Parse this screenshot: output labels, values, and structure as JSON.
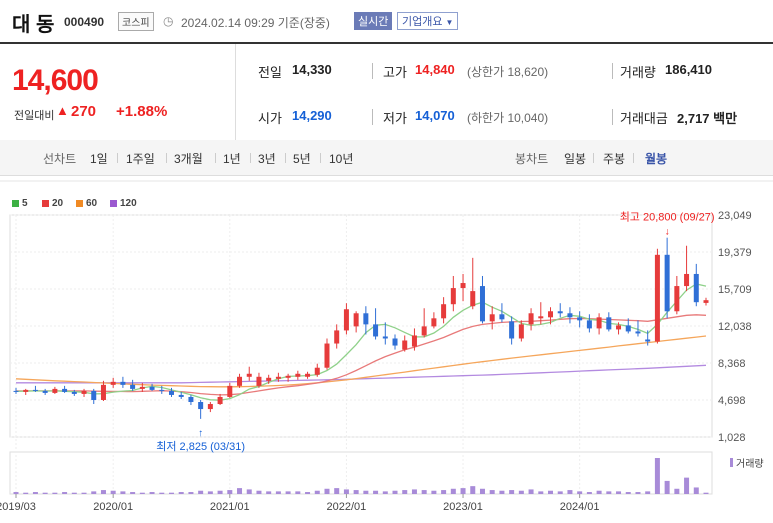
{
  "header": {
    "name": "대 동",
    "code": "000490",
    "market": "코스피",
    "datetime": "2024.02.14 09:29 기준(장중)",
    "live": "실시간",
    "company_info": "기업개요"
  },
  "quote": {
    "price": "14,600",
    "change_label": "전일대비",
    "change_arrow": "▲",
    "change": "270",
    "change_rate": "+1.88%",
    "prev_close_label": "전일",
    "prev_close": "14,330",
    "high_label": "고가",
    "high": "14,840",
    "upper_limit": "(상한가 18,620)",
    "volume_label": "거래량",
    "volume": "186,410",
    "open_label": "시가",
    "open": "14,290",
    "low_label": "저가",
    "low": "14,070",
    "lower_limit": "(하한가 10,040)",
    "value_label": "거래대금",
    "value": "2,717 백만"
  },
  "tabs": {
    "line_label": "선차트",
    "line_periods": [
      "1일",
      "1주일",
      "3개월",
      "1년",
      "3년",
      "5년",
      "10년"
    ],
    "candle_label": "봉차트",
    "candle_periods": [
      "일봉",
      "주봉",
      "월봉"
    ],
    "active_candle": "월봉"
  },
  "legend": [
    {
      "label": "5",
      "color": "#3cb043"
    },
    {
      "label": "20",
      "color": "#e63b3b"
    },
    {
      "label": "60",
      "color": "#f08a24"
    },
    {
      "label": "120",
      "color": "#9b59d0"
    }
  ],
  "colors": {
    "up": "#e63b3b",
    "down": "#2f6fd6",
    "ma5": "#8fd18a",
    "ma20": "#e87a7a",
    "ma60": "#f5a65b",
    "ma120": "#b38ae0",
    "volume": "#a88bd8"
  },
  "chart_data": {
    "type": "candlestick",
    "y_ticks": [
      "23,049",
      "19,379",
      "15,709",
      "12,038",
      "8,368",
      "4,698",
      "1,028"
    ],
    "ylim": [
      1028,
      23049
    ],
    "x_ticks": [
      "2019/03",
      "2020/01",
      "2021/01",
      "2022/01",
      "2023/01",
      "2024/01"
    ],
    "max_annotation": "최고 20,800 (09/27)",
    "min_annotation": "최저 2,825 (03/31)",
    "volume_label": "거래량",
    "candles": [
      {
        "o": 5600,
        "h": 5900,
        "l": 5300,
        "c": 5500
      },
      {
        "o": 5500,
        "h": 5800,
        "l": 5200,
        "c": 5700
      },
      {
        "o": 5700,
        "h": 6100,
        "l": 5500,
        "c": 5600
      },
      {
        "o": 5600,
        "h": 5800,
        "l": 5200,
        "c": 5400
      },
      {
        "o": 5400,
        "h": 6000,
        "l": 5300,
        "c": 5800
      },
      {
        "o": 5800,
        "h": 6100,
        "l": 5400,
        "c": 5500
      },
      {
        "o": 5500,
        "h": 5700,
        "l": 5100,
        "c": 5300
      },
      {
        "o": 5300,
        "h": 5800,
        "l": 5000,
        "c": 5600
      },
      {
        "o": 5600,
        "h": 5800,
        "l": 4300,
        "c": 4700
      },
      {
        "o": 4700,
        "h": 6600,
        "l": 4600,
        "c": 6200
      },
      {
        "o": 6200,
        "h": 6900,
        "l": 5900,
        "c": 6500
      },
      {
        "o": 6500,
        "h": 7000,
        "l": 5900,
        "c": 6200
      },
      {
        "o": 6200,
        "h": 6700,
        "l": 5600,
        "c": 5800
      },
      {
        "o": 5800,
        "h": 6400,
        "l": 5500,
        "c": 6000
      },
      {
        "o": 6000,
        "h": 6300,
        "l": 5600,
        "c": 5700
      },
      {
        "o": 5700,
        "h": 6100,
        "l": 5300,
        "c": 5600
      },
      {
        "o": 5600,
        "h": 5900,
        "l": 5000,
        "c": 5200
      },
      {
        "o": 5200,
        "h": 5500,
        "l": 4800,
        "c": 5000
      },
      {
        "o": 5000,
        "h": 5200,
        "l": 4200,
        "c": 4500
      },
      {
        "o": 4500,
        "h": 4700,
        "l": 2825,
        "c": 3800
      },
      {
        "o": 3800,
        "h": 4500,
        "l": 3500,
        "c": 4300
      },
      {
        "o": 4300,
        "h": 5300,
        "l": 4200,
        "c": 5000
      },
      {
        "o": 5000,
        "h": 6400,
        "l": 4900,
        "c": 6100
      },
      {
        "o": 6100,
        "h": 7300,
        "l": 5900,
        "c": 7000
      },
      {
        "o": 7000,
        "h": 8000,
        "l": 6600,
        "c": 7300
      },
      {
        "o": 6100,
        "h": 7400,
        "l": 5900,
        "c": 7000
      },
      {
        "o": 6600,
        "h": 7200,
        "l": 6300,
        "c": 6900
      },
      {
        "o": 6800,
        "h": 7400,
        "l": 6500,
        "c": 7000
      },
      {
        "o": 6900,
        "h": 7300,
        "l": 6500,
        "c": 7100
      },
      {
        "o": 7000,
        "h": 7600,
        "l": 6700,
        "c": 7300
      },
      {
        "o": 7000,
        "h": 7500,
        "l": 6800,
        "c": 7300
      },
      {
        "o": 7200,
        "h": 8300,
        "l": 7000,
        "c": 7900
      },
      {
        "o": 7900,
        "h": 10800,
        "l": 7700,
        "c": 10300
      },
      {
        "o": 10300,
        "h": 12200,
        "l": 9800,
        "c": 11600
      },
      {
        "o": 11600,
        "h": 14300,
        "l": 11200,
        "c": 13700
      },
      {
        "o": 12000,
        "h": 13500,
        "l": 11400,
        "c": 13300
      },
      {
        "o": 13300,
        "h": 14000,
        "l": 11200,
        "c": 12200
      },
      {
        "o": 12200,
        "h": 13800,
        "l": 10700,
        "c": 11000
      },
      {
        "o": 11000,
        "h": 12400,
        "l": 10200,
        "c": 10800
      },
      {
        "o": 10800,
        "h": 11200,
        "l": 9700,
        "c": 10100
      },
      {
        "o": 9700,
        "h": 11100,
        "l": 9500,
        "c": 10600
      },
      {
        "o": 10000,
        "h": 11800,
        "l": 9600,
        "c": 11100
      },
      {
        "o": 11100,
        "h": 13800,
        "l": 10900,
        "c": 12000
      },
      {
        "o": 12000,
        "h": 13400,
        "l": 11800,
        "c": 12800
      },
      {
        "o": 12800,
        "h": 14900,
        "l": 12300,
        "c": 14200
      },
      {
        "o": 14200,
        "h": 17000,
        "l": 13500,
        "c": 15800
      },
      {
        "o": 15800,
        "h": 17200,
        "l": 14500,
        "c": 16300
      },
      {
        "o": 14000,
        "h": 18800,
        "l": 13700,
        "c": 15500
      },
      {
        "o": 16000,
        "h": 17000,
        "l": 12300,
        "c": 12500
      },
      {
        "o": 12500,
        "h": 14000,
        "l": 11700,
        "c": 13200
      },
      {
        "o": 13200,
        "h": 14300,
        "l": 12400,
        "c": 12700
      },
      {
        "o": 12500,
        "h": 13000,
        "l": 10200,
        "c": 10800
      },
      {
        "o": 10800,
        "h": 12600,
        "l": 10500,
        "c": 12200
      },
      {
        "o": 12200,
        "h": 13800,
        "l": 11600,
        "c": 13300
      },
      {
        "o": 12800,
        "h": 14400,
        "l": 12200,
        "c": 13000
      },
      {
        "o": 12900,
        "h": 13900,
        "l": 12200,
        "c": 13500
      },
      {
        "o": 13500,
        "h": 14300,
        "l": 12900,
        "c": 13300
      },
      {
        "o": 13300,
        "h": 13900,
        "l": 12300,
        "c": 12900
      },
      {
        "o": 12900,
        "h": 13500,
        "l": 11900,
        "c": 12600
      },
      {
        "o": 12600,
        "h": 13200,
        "l": 11400,
        "c": 11800
      },
      {
        "o": 11800,
        "h": 13300,
        "l": 11200,
        "c": 12900
      },
      {
        "o": 12900,
        "h": 13400,
        "l": 11500,
        "c": 11700
      },
      {
        "o": 11700,
        "h": 12400,
        "l": 11200,
        "c": 12100
      },
      {
        "o": 12100,
        "h": 12800,
        "l": 11300,
        "c": 11500
      },
      {
        "o": 11500,
        "h": 12600,
        "l": 11000,
        "c": 11300
      },
      {
        "o": 10700,
        "h": 11600,
        "l": 10100,
        "c": 10500
      },
      {
        "o": 10500,
        "h": 19700,
        "l": 10300,
        "c": 19100
      },
      {
        "o": 19100,
        "h": 20800,
        "l": 12800,
        "c": 13500
      },
      {
        "o": 13500,
        "h": 17000,
        "l": 13200,
        "c": 16000
      },
      {
        "o": 16000,
        "h": 20000,
        "l": 15500,
        "c": 17200
      },
      {
        "o": 17200,
        "h": 18200,
        "l": 14000,
        "c": 14400
      },
      {
        "o": 14330,
        "h": 14840,
        "l": 14070,
        "c": 14600
      }
    ],
    "ma5": [
      5550,
      5570,
      5600,
      5580,
      5600,
      5560,
      5520,
      5460,
      5300,
      5320,
      5480,
      5580,
      5640,
      5900,
      6050,
      5940,
      5700,
      5460,
      5220,
      4920,
      4720,
      4680,
      4840,
      5220,
      5780,
      6040,
      6440,
      6800,
      7040,
      7080,
      7120,
      7220,
      7620,
      8260,
      9200,
      10180,
      11380,
      12120,
      12200,
      11860,
      11400,
      10960,
      10960,
      11340,
      12000,
      12900,
      13600,
      14100,
      14400,
      13900,
      13500,
      12900,
      12300,
      12100,
      12200,
      12400,
      12800,
      13100,
      13000,
      12700,
      12600,
      12300,
      12200,
      12000,
      11700,
      11300,
      12200,
      13400,
      14500,
      15600,
      16200,
      16000
    ],
    "ma20": [
      5600,
      5600,
      5600,
      5600,
      5600,
      5600,
      5600,
      5600,
      5580,
      5560,
      5550,
      5540,
      5530,
      5560,
      5590,
      5620,
      5580,
      5520,
      5440,
      5330,
      5250,
      5200,
      5220,
      5300,
      5450,
      5600,
      5760,
      5900,
      6020,
      6120,
      6250,
      6380,
      6580,
      6850,
      7200,
      7620,
      8100,
      8580,
      9000,
      9350,
      9680,
      9950,
      10250,
      10560,
      10900,
      11300,
      11700,
      12000,
      12200,
      12300,
      12400,
      12450,
      12480,
      12500,
      12560,
      12620,
      12700,
      12760,
      12780,
      12760,
      12720,
      12680,
      12640,
      12600,
      12560,
      12500,
      12650,
      12800,
      12950,
      13100,
      13150,
      13100
    ],
    "ma60": [
      6800,
      6750,
      6700,
      6650,
      6600,
      6560,
      6520,
      6480,
      6430,
      6380,
      6340,
      6300,
      6260,
      6220,
      6180,
      6150,
      6120,
      6090,
      6060,
      6030,
      6020,
      6010,
      6010,
      6020,
      6040,
      6070,
      6100,
      6140,
      6190,
      6250,
      6320,
      6400,
      6490,
      6590,
      6700,
      6820,
      6950,
      7080,
      7210,
      7340,
      7470,
      7600,
      7730,
      7860,
      7990,
      8120,
      8250,
      8380,
      8500,
      8620,
      8740,
      8850,
      8960,
      9070,
      9180,
      9290,
      9400,
      9510,
      9620,
      9730,
      9840,
      9950,
      10060,
      10170,
      10280,
      10390,
      10500,
      10610,
      10720,
      10830,
      10940,
      11050
    ],
    "ma120": [
      6400,
      6400,
      6400,
      6400,
      6400,
      6400,
      6400,
      6400,
      6400,
      6400,
      6400,
      6400,
      6400,
      6400,
      6400,
      6400,
      6400,
      6400,
      6420,
      6440,
      6460,
      6480,
      6500,
      6520,
      6540,
      6560,
      6580,
      6600,
      6620,
      6640,
      6660,
      6680,
      6700,
      6720,
      6750,
      6780,
      6810,
      6840,
      6870,
      6900,
      6930,
      6960,
      6990,
      7020,
      7050,
      7080,
      7110,
      7140,
      7170,
      7200,
      7240,
      7280,
      7320,
      7360,
      7400,
      7440,
      7480,
      7520,
      7560,
      7600,
      7640,
      7680,
      7720,
      7760,
      7800,
      7840,
      7890,
      7940,
      7990,
      8040,
      8090,
      8140
    ],
    "volume": [
      3,
      2,
      3,
      2,
      2,
      3,
      2,
      2,
      4,
      6,
      5,
      4,
      3,
      2,
      3,
      2,
      2,
      3,
      3,
      5,
      4,
      5,
      6,
      9,
      7,
      5,
      4,
      4,
      4,
      4,
      3,
      5,
      8,
      9,
      7,
      6,
      5,
      5,
      4,
      5,
      6,
      7,
      6,
      5,
      6,
      8,
      9,
      12,
      8,
      6,
      5,
      6,
      5,
      7,
      4,
      5,
      4,
      6,
      4,
      3,
      5,
      4,
      4,
      3,
      3,
      4,
      55,
      20,
      8,
      25,
      10,
      2
    ]
  }
}
